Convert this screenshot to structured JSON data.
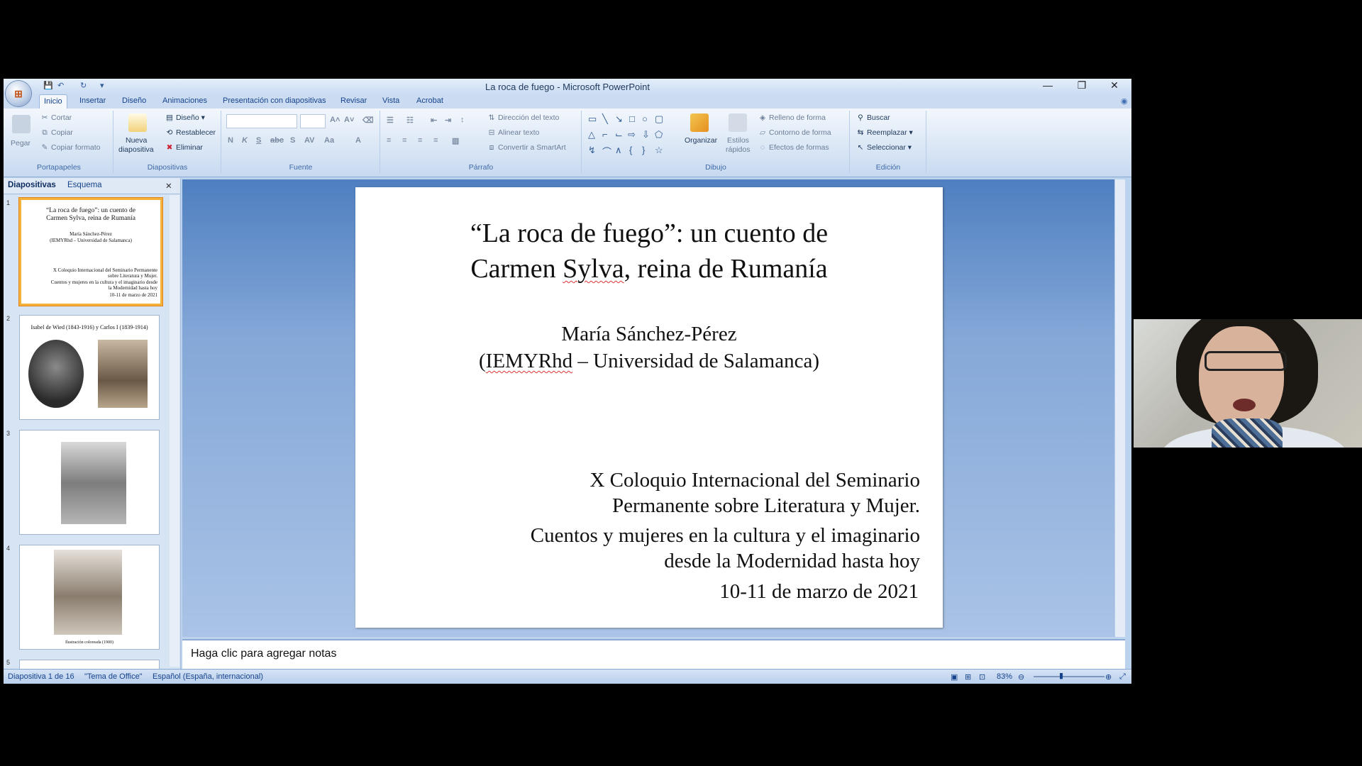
{
  "window": {
    "title": "La roca de fuego - Microsoft PowerPoint"
  },
  "tabs": [
    "Inicio",
    "Insertar",
    "Diseño",
    "Animaciones",
    "Presentación con diapositivas",
    "Revisar",
    "Vista",
    "Acrobat"
  ],
  "ribbon": {
    "portapapeles": {
      "label": "Portapapeles",
      "pegar": "Pegar",
      "cortar": "Cortar",
      "copiar": "Copiar",
      "copiar_formato": "Copiar formato"
    },
    "diapositivas": {
      "label": "Diapositivas",
      "nueva": "Nueva",
      "diapositiva": "diapositiva",
      "diseno": "Diseño",
      "restablecer": "Restablecer",
      "eliminar": "Eliminar"
    },
    "fuente": {
      "label": "Fuente"
    },
    "parrafo": {
      "label": "Párrafo",
      "direccion": "Dirección del texto",
      "alinear": "Alinear texto",
      "convertir": "Convertir a SmartArt"
    },
    "dibujo": {
      "label": "Dibujo",
      "organizar": "Organizar",
      "estilos": "Estilos",
      "rapidos": "rápidos",
      "relleno": "Relleno de forma",
      "contorno": "Contorno de forma",
      "efectos": "Efectos de formas"
    },
    "edicion": {
      "label": "Edición",
      "buscar": "Buscar",
      "reemplazar": "Reemplazar",
      "seleccionar": "Seleccionar"
    }
  },
  "panel": {
    "tab_diapositivas": "Diapositivas",
    "tab_esquema": "Esquema"
  },
  "thumbs": {
    "t1": {
      "num": "1",
      "title": "“La roca de fuego”: un cuento de Carmen Sylva, reina de Rumanía",
      "author": "María Sánchez-Pérez",
      "inst": "(IEMYRhd – Universidad de Salamanca)",
      "colloq": "X Coloquio Internacional del Seminario Permanente sobre Literatura y Mujer.",
      "sub": "Cuentos y mujeres en la cultura y el imaginario desde la Modernidad hasta hoy",
      "date": "10-11 de marzo de 2021"
    },
    "t2": {
      "num": "2",
      "caption": "Isabel de Wied (1843-1916) y Carlos I (1839-1914)"
    },
    "t3": {
      "num": "3"
    },
    "t4": {
      "num": "4",
      "caption": "Ilustración coloreada (1900)"
    },
    "t5": {
      "num": "5"
    }
  },
  "slide": {
    "title_line1": "“La roca de fuego”: un cuento de",
    "title_line2a": "Carmen ",
    "title_sylva": "Sylva",
    "title_line2b": ", reina de Rumanía",
    "author": "María Sánchez-Pérez",
    "inst_open": "(",
    "inst_iemy": "IEMYRhd",
    "inst_rest": " – Universidad de Salamanca)",
    "colloq1": "X Coloquio Internacional del Seminario",
    "colloq2": "Permanente sobre Literatura y Mujer.",
    "sub1": "Cuentos y mujeres en la cultura y el imaginario",
    "sub2": "desde la Modernidad hasta hoy",
    "date": "10-11 de marzo de 2021"
  },
  "notes": {
    "placeholder": "Haga clic para agregar notas"
  },
  "status": {
    "slide": "Diapositiva 1 de 16",
    "theme": "\"Tema de Office\"",
    "lang": "Español (España, internacional)",
    "zoom": "83%"
  }
}
